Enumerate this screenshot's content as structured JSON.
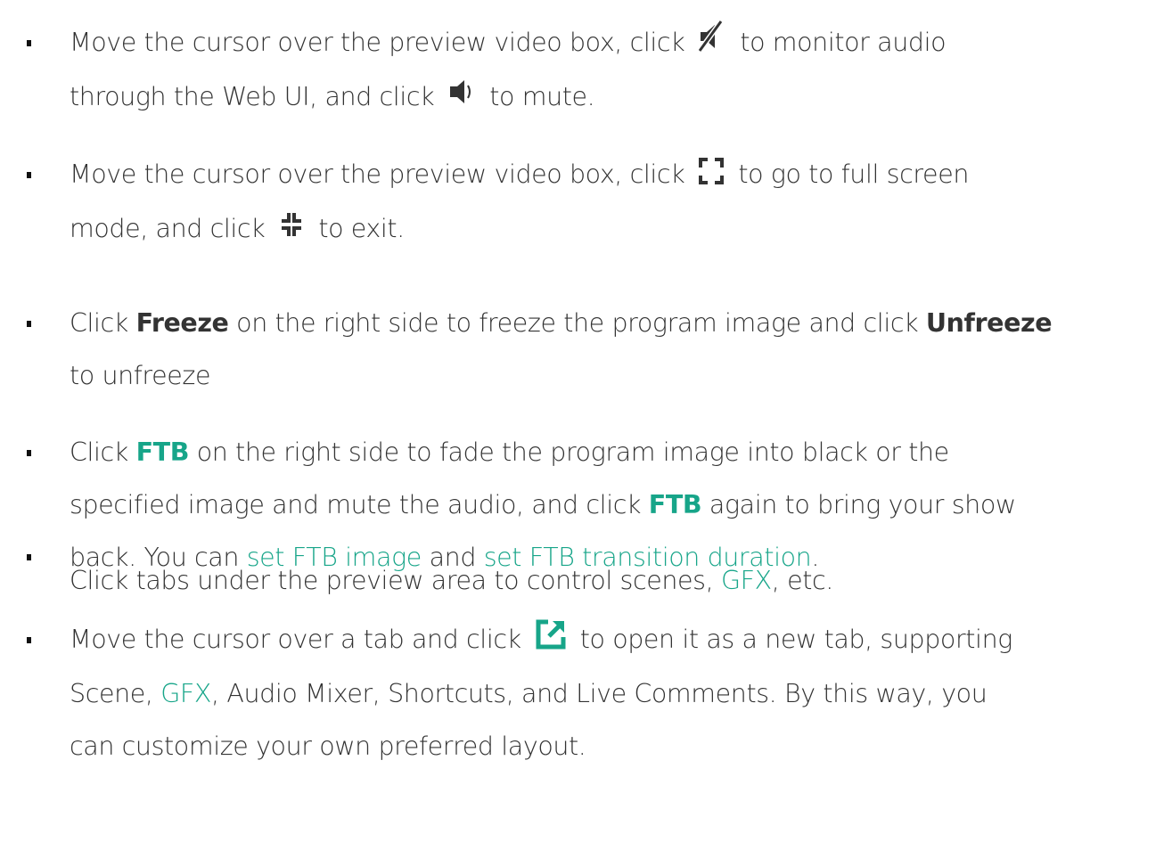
{
  "colors": {
    "text": "#333333",
    "accent": "#17a589",
    "icon": "#333333"
  },
  "bullets": [
    {
      "pre": "Move the cursor over the preview video box, click",
      "icon1": "muted-speaker-icon",
      "mid1": "to monitor audio",
      "line2": "through the Web UI, and click",
      "icon2": "speaker-on-icon",
      "post": "to mute."
    },
    {
      "pre": "Move the cursor over the preview video box, click",
      "icon1": "fullscreen-enter-icon",
      "mid1": "to go to full screen",
      "line2": "mode, and click",
      "icon2": "fullscreen-exit-icon",
      "post": "to exit."
    },
    {
      "t1": "Click",
      "b1": "Freeze",
      "t2": "on the right side to freeze the program image and click",
      "b2": "Unfreeze",
      "t3": "to unfreeze"
    },
    {
      "t1": "Click",
      "b1": "FTB",
      "t2": "on the right side to fade the program image into black or the",
      "t3": "specified image and mute the audio, and click",
      "b2": "FTB",
      "t4": "again to bring your show",
      "t5": "back. You can",
      "link1": "set FTB image",
      "t6": "and",
      "link2": "set FTB transition duration",
      "t7": "."
    },
    {
      "t1": "Click tabs under the preview area to control scenes,",
      "link1": "GFX",
      "t2": ", etc."
    },
    {
      "t1": "Move the cursor over a tab and click",
      "icon": "open-in-new-tab-icon",
      "t2": "to open it as a new tab, supporting",
      "t3": "Scene,",
      "link1": "GFX",
      "t4": ", Audio Mixer, Shortcuts, and Live Comments. By this way, you",
      "t5": "can customize your own preferred layout."
    }
  ]
}
